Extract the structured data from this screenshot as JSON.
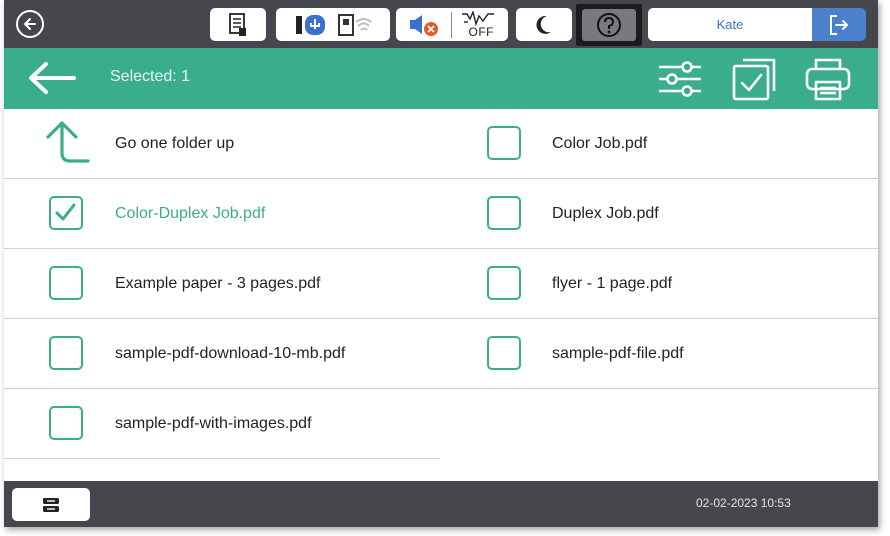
{
  "statusbar": {
    "user": "Kate",
    "status_icons": [
      "document-status-icon",
      "usb-memory-icon",
      "wifi-icon",
      "sound-muted-icon",
      "fax-off-icon",
      "sleep-moon-icon",
      "help-icon",
      "logout-icon"
    ],
    "fax_off_label": "OFF"
  },
  "header": {
    "selected_text": "Selected: 1"
  },
  "list": {
    "left": [
      {
        "label": "Go one folder up",
        "type": "folder-up"
      },
      {
        "label": "Color-Duplex Job.pdf",
        "checked": true
      },
      {
        "label": "Example paper - 3 pages.pdf",
        "checked": false
      },
      {
        "label": "sample-pdf-download-10-mb.pdf",
        "checked": false
      },
      {
        "label": "sample-pdf-with-images.pdf",
        "checked": false
      }
    ],
    "right": [
      {
        "label": "Color Job.pdf",
        "checked": false
      },
      {
        "label": "Duplex Job.pdf",
        "checked": false
      },
      {
        "label": "flyer - 1 page.pdf",
        "checked": false
      },
      {
        "label": "sample-pdf-file.pdf",
        "checked": false
      }
    ]
  },
  "footer": {
    "datetime": "02-02-2023 10:53"
  },
  "colors": {
    "accent": "#3aae8a",
    "bar": "#45474c",
    "user_text": "#3b6fd1",
    "logout_bg": "#4a80cc"
  }
}
